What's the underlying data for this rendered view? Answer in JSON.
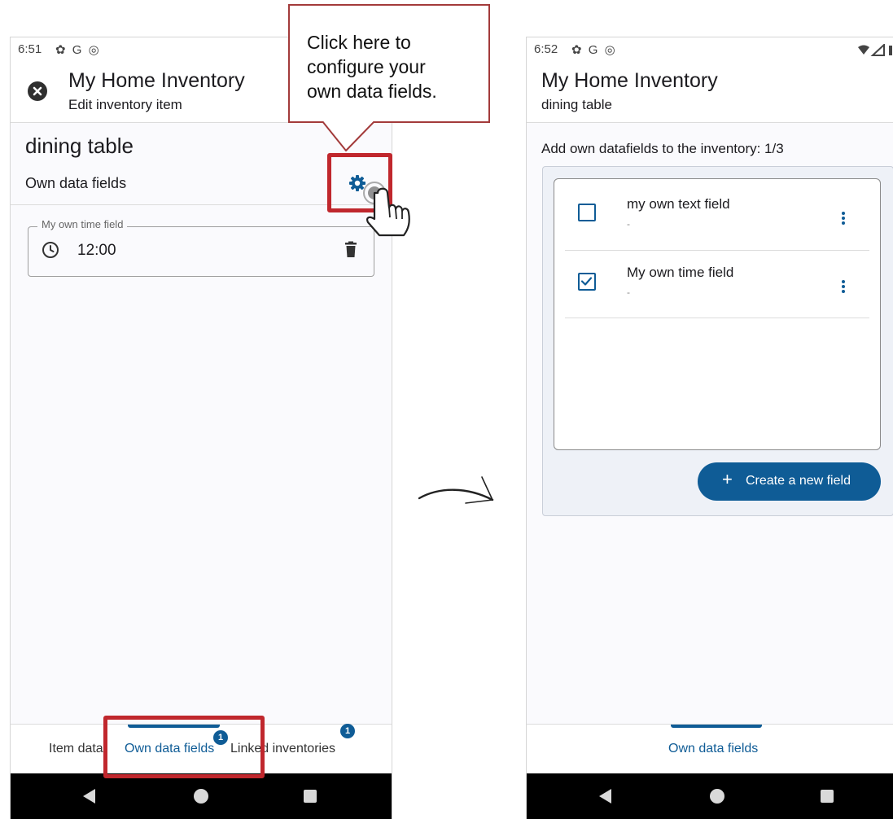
{
  "callout": {
    "text_lines": [
      "Click here to",
      "configure your",
      "own data fields."
    ]
  },
  "left_screen": {
    "status": {
      "time": "6:51",
      "icons": "✿ G ◎"
    },
    "header": {
      "title": "My Home Inventory",
      "subtitle": "Edit inventory item"
    },
    "item_name": "dining table",
    "section_title": "Own data fields",
    "time_field": {
      "legend": "My own time field",
      "value": "12:00"
    },
    "tabs": [
      {
        "label": "Item data"
      },
      {
        "label": "Own data fields",
        "badge": "1"
      },
      {
        "label": "Linked inventories",
        "badge": "1"
      }
    ]
  },
  "right_screen": {
    "status": {
      "time": "6:52",
      "icons": "✿ G ◎"
    },
    "header": {
      "title": "My Home Inventory",
      "subtitle": "dining table"
    },
    "add_label": "Add own datafields to the inventory: 1/3",
    "fields": [
      {
        "name": "my own text field",
        "sub": "-",
        "checked": false
      },
      {
        "name": "My own time field",
        "sub": "-",
        "checked": true
      }
    ],
    "create_button": "Create a new field",
    "tab": "Own data fields"
  },
  "colors": {
    "accent": "#0f5c96",
    "highlight": "#c0272d",
    "callout_border": "#a33b3b"
  }
}
